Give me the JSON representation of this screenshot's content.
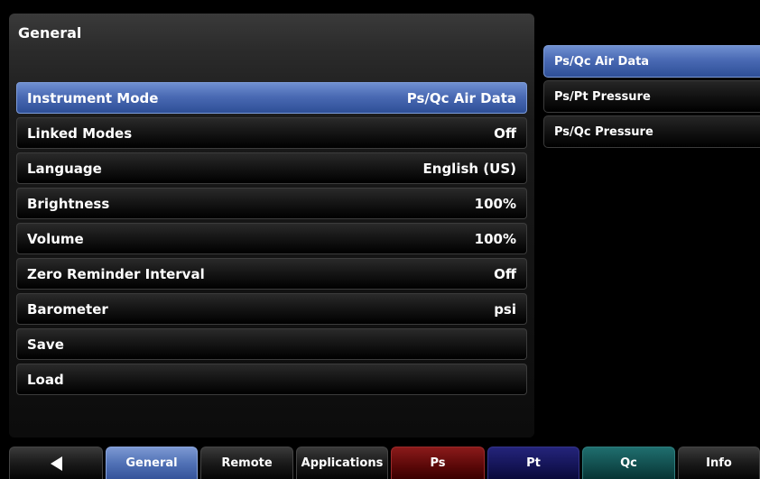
{
  "panel": {
    "title": "General",
    "settings": [
      {
        "label": "Instrument Mode",
        "value": "Ps/Qc Air Data",
        "selected": true
      },
      {
        "label": "Linked Modes",
        "value": "Off"
      },
      {
        "label": "Language",
        "value": "English (US)"
      },
      {
        "label": "Brightness",
        "value": "100%"
      },
      {
        "label": "Volume",
        "value": "100%"
      },
      {
        "label": "Zero Reminder Interval",
        "value": "Off"
      },
      {
        "label": "Barometer",
        "value": "psi"
      },
      {
        "label": "Save",
        "value": ""
      },
      {
        "label": "Load",
        "value": ""
      }
    ]
  },
  "options": {
    "items": [
      {
        "label": "Ps/Qc Air Data",
        "selected": true
      },
      {
        "label": "Ps/Pt Pressure"
      },
      {
        "label": "Ps/Qc Pressure"
      }
    ]
  },
  "tabs": {
    "back_icon": "back-arrow-icon",
    "general": "General",
    "remote": "Remote",
    "applications": "Applications",
    "ps": "Ps",
    "pt": "Pt",
    "qc": "Qc",
    "info": "Info"
  },
  "colors": {
    "selected": "#4a6ab4",
    "ps_tab": "#5a0808",
    "pt_tab": "#141456",
    "qc_tab": "#114c4c"
  }
}
